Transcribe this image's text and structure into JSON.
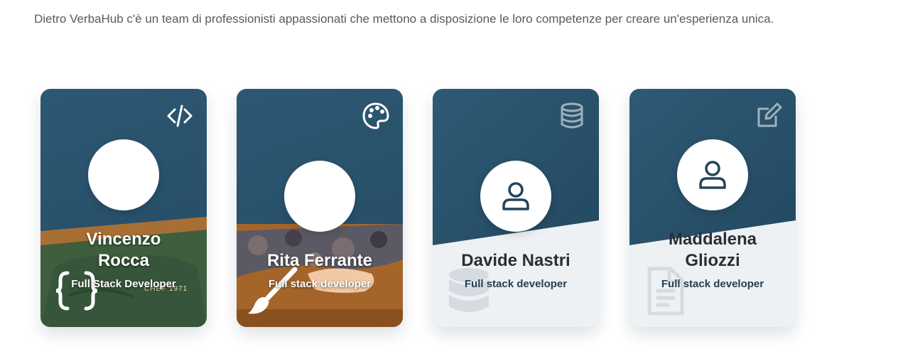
{
  "intro": {
    "text": "Dietro VerbaHub c'è un team di professionisti appassionati che mettono a disposizione le loro competenze per creare un'esperienza unica."
  },
  "team": [
    {
      "name_line1": "Vincenzo",
      "name_line2": "Rocca",
      "role": "Full Stack Developer",
      "corner_icon": "code-icon",
      "background_icon": "curly-braces-icon",
      "shirt_text": "CHEF 1971"
    },
    {
      "name": "Rita Ferrante",
      "role": "Full stack developer",
      "corner_icon": "palette-icon",
      "background_icon": "paintbrush-icon"
    },
    {
      "name": "Davide Nastri",
      "role": "Full stack developer",
      "corner_icon": "database-icon",
      "background_icon": "database-icon",
      "avatar_icon": "user-icon"
    },
    {
      "name_line1": "Maddalena",
      "name_line2": "Gliozzi",
      "role": "Full stack developer",
      "corner_icon": "edit-icon",
      "background_icon": "document-icon",
      "avatar_icon": "user-icon"
    }
  ],
  "colors": {
    "card_dark": "#2d5873",
    "card_light": "#eef1f4",
    "text_dark": "#2a2f35"
  }
}
